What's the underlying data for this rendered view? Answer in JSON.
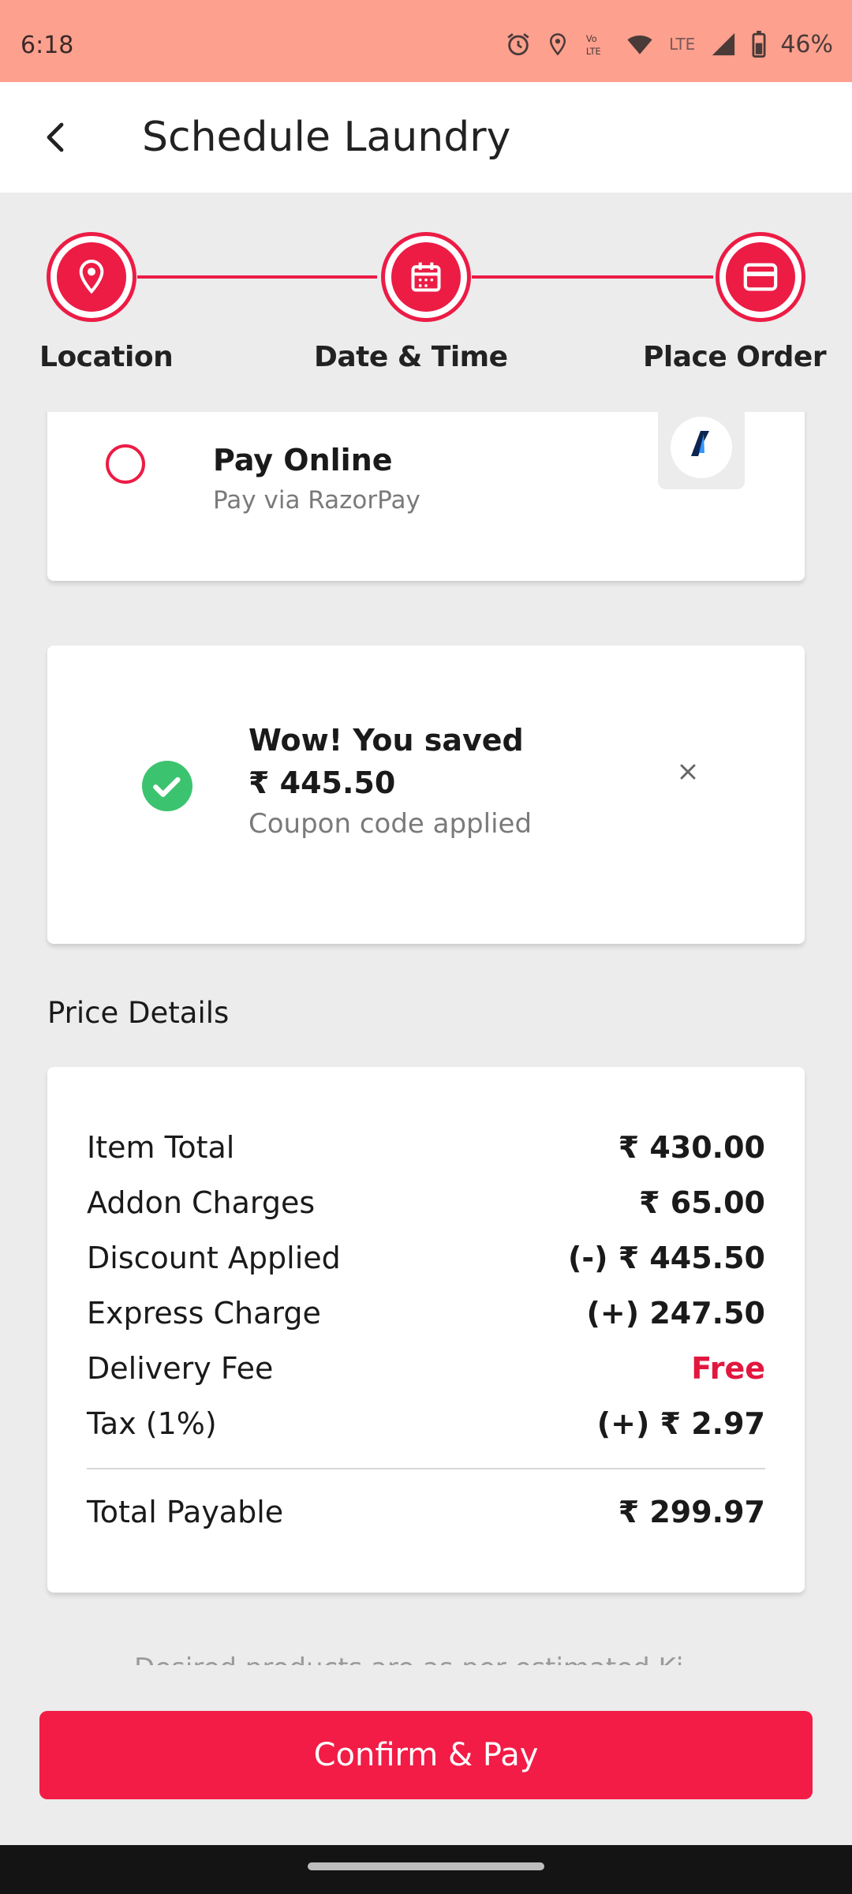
{
  "status_bar": {
    "time": "6:18",
    "battery": "46%",
    "network_label": "LTE"
  },
  "header": {
    "title": "Schedule Laundry"
  },
  "stepper": {
    "steps": [
      {
        "label": "Location",
        "icon": "location-pin-icon"
      },
      {
        "label": "Date & Time",
        "icon": "calendar-icon"
      },
      {
        "label": "Place Order",
        "icon": "credit-card-icon"
      }
    ]
  },
  "payment": {
    "option_title": "Pay Online",
    "option_subtitle": "Pay via RazorPay",
    "logo_text": "Razorpay",
    "selected": false
  },
  "coupon": {
    "title": "Wow! You saved",
    "amount": "₹ 445.50",
    "subtitle": "Coupon code applied"
  },
  "price_details": {
    "section_title": "Price Details",
    "rows": [
      {
        "label": "Item Total",
        "value": "₹ 430.00"
      },
      {
        "label": "Addon Charges",
        "value": "₹ 65.00"
      },
      {
        "label": "Discount Applied",
        "value": "(-) ₹ 445.50"
      },
      {
        "label": "Express Charge",
        "value": "(+) 247.50"
      },
      {
        "label": "Delivery Fee",
        "value": "Free"
      },
      {
        "label": "Tax (1%)",
        "value": "(+) ₹ 2.97"
      }
    ],
    "total_label": "Total Payable",
    "total_value": "₹ 299.97"
  },
  "footer_note_clipped": "Desired products are as per estimated Ki",
  "confirm_button": "Confirm & Pay",
  "colors": {
    "accent": "#ec1c45",
    "status_bar": "#fda08e",
    "success": "#3cc36f",
    "free": "#e2173f"
  }
}
